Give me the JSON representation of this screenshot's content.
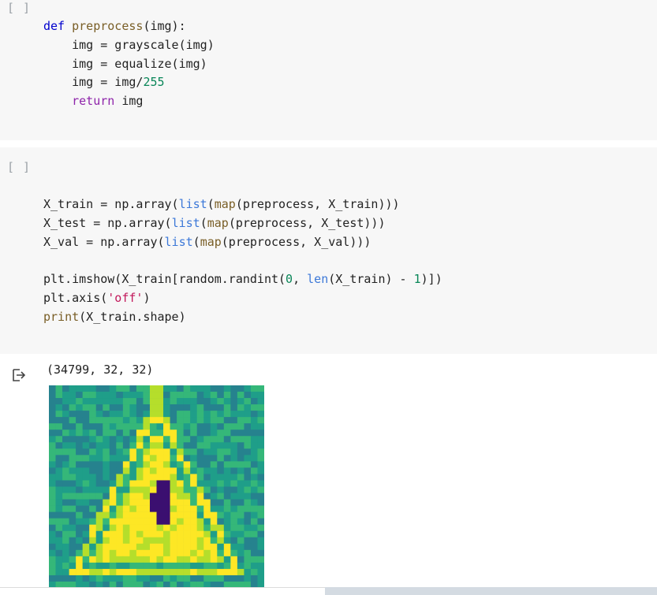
{
  "cells": [
    {
      "run_indicator": "[ ]",
      "lines": [
        "def preprocess(img):",
        "    img = grayscale(img)",
        "    img = equalize(img)",
        "    img = img/255",
        "    return img"
      ]
    },
    {
      "run_indicator": "[ ]",
      "lines": [
        "X_train = np.array(list(map(preprocess, X_train)))",
        "X_test = np.array(list(map(preprocess, X_test)))",
        "X_val = np.array(list(map(preprocess, X_val)))",
        "",
        "plt.imshow(X_train[random.randint(0, len(X_train) - 1)])",
        "plt.axis('off')",
        "print(X_train.shape)"
      ]
    }
  ],
  "output": {
    "icon": "output-arrow-icon",
    "text": "(34799, 32, 32)",
    "image": {
      "description_icon": "traffic-sign-image",
      "colormap": "viridis"
    }
  },
  "colors": {
    "cell_background": "#f7f7f7",
    "keyword": "#0000cd",
    "control_keyword": "#8e24aa",
    "builtin": "#3c78d8",
    "number": "#098658",
    "string": "#c2185b"
  }
}
